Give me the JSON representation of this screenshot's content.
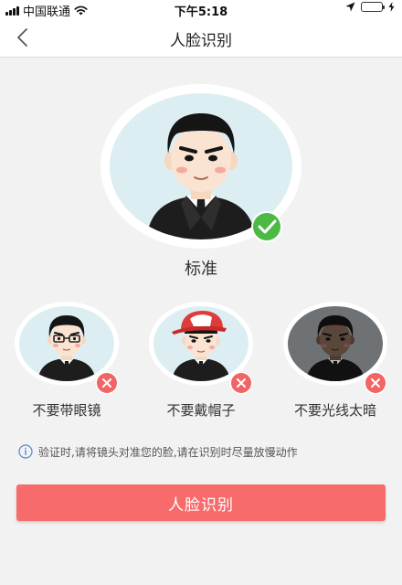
{
  "status_bar": {
    "carrier": "中国联通",
    "time": "下午5:18"
  },
  "nav": {
    "title": "人脸识别",
    "back_icon": "chevron-left-icon"
  },
  "main_photo": {
    "label": "标准",
    "badge_icon": "check-icon"
  },
  "examples": [
    {
      "label": "不要带眼镜",
      "badge_icon": "close-icon"
    },
    {
      "label": "不要戴帽子",
      "badge_icon": "close-icon"
    },
    {
      "label": "不要光线太暗",
      "badge_icon": "close-icon"
    }
  ],
  "notice": {
    "icon": "info-icon",
    "text": "验证时,请将镜头对准您的脸,请在识别时尽量放慢动作"
  },
  "submit": {
    "label": "人脸识别"
  },
  "colors": {
    "accent": "#f76b6b",
    "success": "#4cb944",
    "error_badge": "#f06565",
    "avatar_bg": "#ddeef3",
    "dark_avatar_bg": "#6e7274"
  }
}
